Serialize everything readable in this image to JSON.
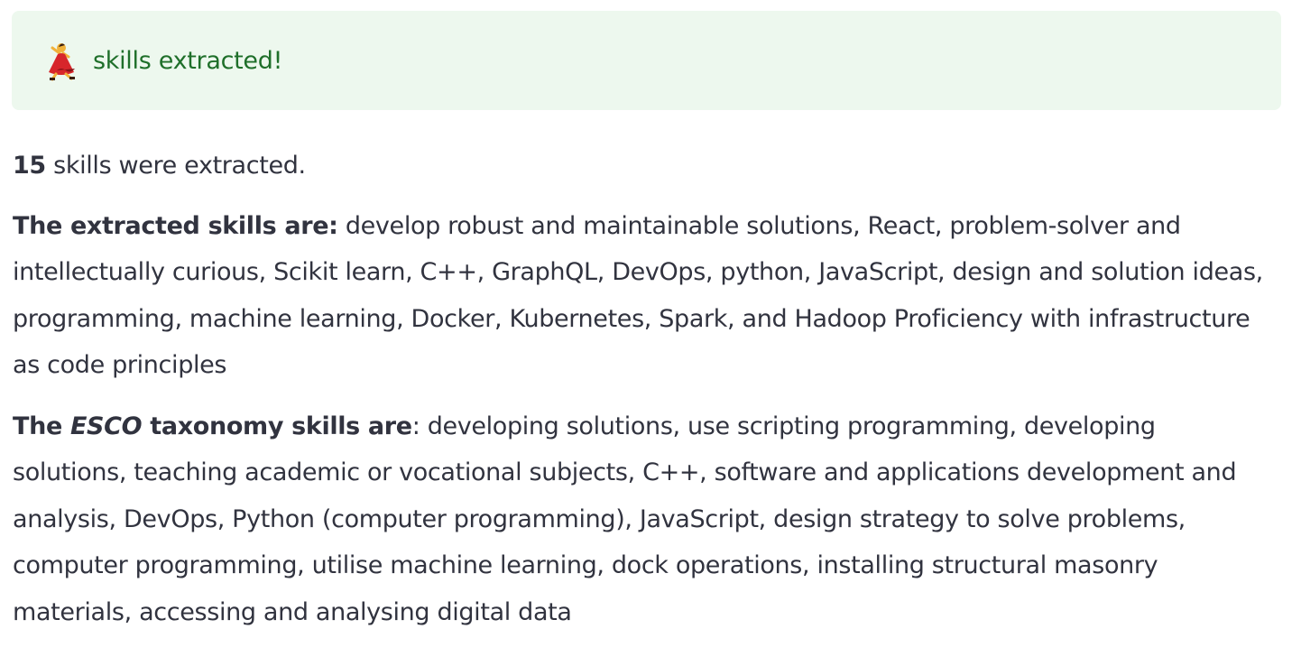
{
  "alert": {
    "icon": "dancer-icon",
    "text": "skills extracted!",
    "background": "#edf8ee",
    "text_color": "#1f6f2a"
  },
  "summary": {
    "count": "15",
    "count_suffix": " skills were extracted."
  },
  "extracted": {
    "label": "The extracted skills are:",
    "skills": " develop robust and maintainable solutions, React, problem-solver and intellectually curious, Scikit learn, C++, GraphQL, DevOps, python, JavaScript, design and solution ideas, programming, machine learning, Docker, Kubernetes, Spark, and Hadoop Proficiency with infrastructure as code principles"
  },
  "esco": {
    "label_prefix": "The ",
    "label_italic": "ESCO",
    "label_suffix": " taxonomy skills are",
    "skills": ": developing solutions, use scripting programming, developing solutions, teaching academic or vocational subjects, C++, software and applications development and analysis, DevOps, Python (computer programming), JavaScript, design strategy to solve problems, computer programming, utilise machine learning, dock operations, installing structural masonry materials, accessing and analysing digital data"
  }
}
